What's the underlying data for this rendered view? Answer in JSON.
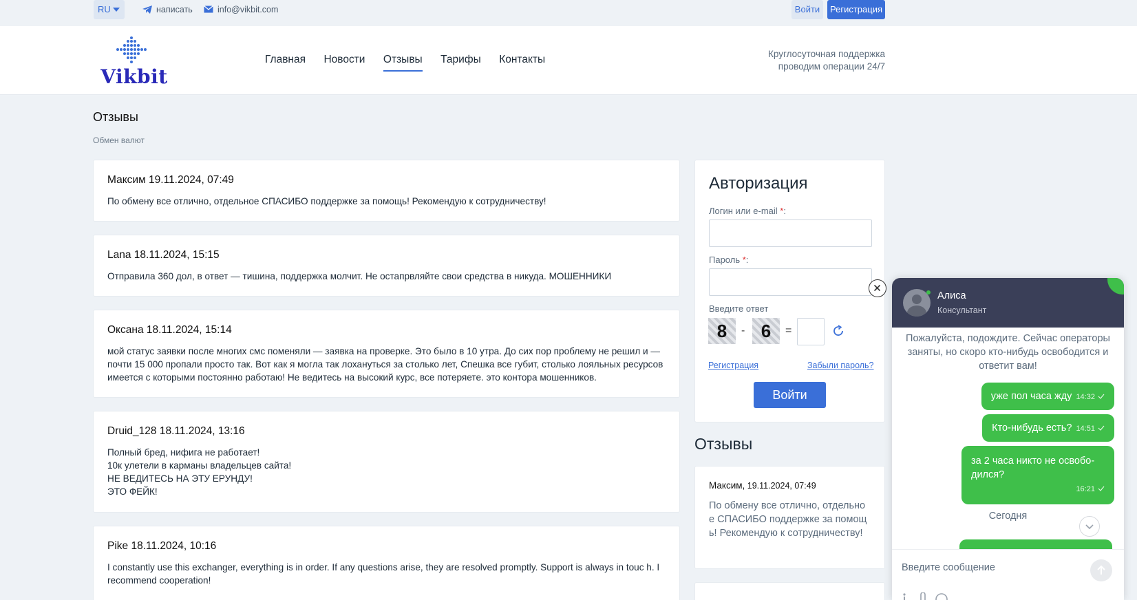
{
  "topbar": {
    "lang": "RU",
    "write_label": "написать",
    "email": "info@vikbit.com",
    "login_label": "Войти",
    "register_label": "Регистрация"
  },
  "header": {
    "logo_text": "Vikbit",
    "nav": [
      "Главная",
      "Новости",
      "Отзывы",
      "Тарифы",
      "Контакты"
    ],
    "active_nav": "Отзывы",
    "support_line1": "Круглосуточная поддержка",
    "support_line2": "проводим операции 24/7"
  },
  "page": {
    "title": "Отзывы",
    "breadcrumb": "Обмен валют"
  },
  "reviews": [
    {
      "author": "Максим",
      "date": "19.11.2024, 07:49",
      "text": "По обмену все отлично, отдельное СПАСИБО поддержке за помощь! Рекомендую к сотрудничеству!"
    },
    {
      "author": "Lana",
      "date": "18.11.2024, 15:15",
      "text": "Отправила 360 дол, в ответ — тишина, поддержка молчит. Не остапрвляйте свои средства в никуда. МОШЕННИКИ"
    },
    {
      "author": "Оксана",
      "date": "18.11.2024, 15:14",
      "text": "мой статус заявки после многих смс поменяли — заявка на проверке. Это было в 10 утра. До сих пор проблему не решил и — почти 15 000 пропали просто так. Вот как я могла так лохануться за столько лет, Спешка все губит, столько лояльных ресурсов имеется с которыми постоянно работаю! Не ведитесь на высокий курс, все потеряете. это контора мошенников."
    },
    {
      "author": "Druid_128",
      "date": "18.11.2024, 13:16",
      "text": "Полный бред, нифига не работает!\n10к улетели в карманы владельцев сайта!\nНЕ ВЕДИТЕСЬ НА ЭТУ ЕРУНДУ!\nЭТО ФЕЙК!"
    },
    {
      "author": "Pike",
      "date": "18.11.2024, 10:16",
      "text": "I constantly use this exchanger, everything is in order. If any questions arise, they are resolved promptly. Support is always in touc h. I recommend cooperation!"
    }
  ],
  "auth": {
    "title": "Авторизация",
    "login_label": "Логин или e-mail",
    "password_label": "Пароль",
    "required_mark": "*",
    "captcha_label": "Введите ответ",
    "captcha_a": "8",
    "captcha_op": "-",
    "captcha_b": "6",
    "captcha_eq": "=",
    "register_link": "Регистрация",
    "forgot_link": "Забыли пароль?",
    "submit_label": "Войти"
  },
  "sidebar": {
    "title": "Отзывы",
    "cards": [
      {
        "author": "Максим,",
        "date": "19.11.2024, 07:49",
        "text": "По обмену все отлично, отдельное СПАСИБО поддержке за помощь! Рекомендую к сотрудничеству!"
      }
    ]
  },
  "chat": {
    "agent_name": "Алиса",
    "agent_role": "Консультант",
    "wait_text": "Пожалуйста, подождите. Сейчас операторы заняты, но скоро кто-нибудь освободится и ответит вам!",
    "messages": [
      {
        "text": "уже пол часа жду",
        "time": "14:32"
      },
      {
        "text": "Кто-нибудь есть?",
        "time": "14:51"
      },
      {
        "text": "за 2 часа никто не освобо-дился?",
        "time": "16:21"
      }
    ],
    "today_label": "Сегодня",
    "input_placeholder": "Введите сообщение"
  },
  "colors": {
    "accent": "#3a6fd8",
    "chat_green": "#3fbf4a",
    "chat_header": "#3a3f58",
    "logo_blue": "#2a2ab8"
  }
}
